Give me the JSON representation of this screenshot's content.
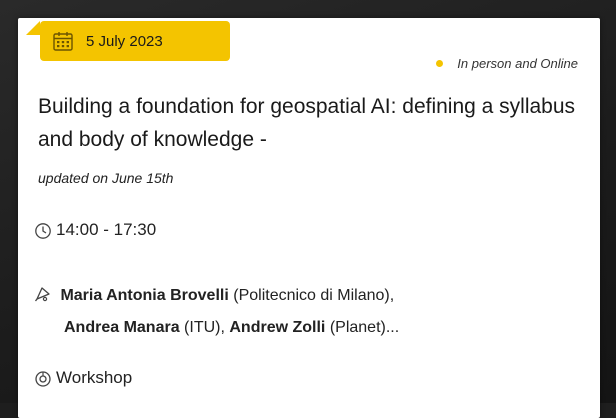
{
  "event": {
    "date": "5 July 2023",
    "format": "In person and Online",
    "title": "Building a foundation for geospatial AI: defining a syllabus and body of knowledge -",
    "updated": "updated on June 15th",
    "time": "14:00 - 17:30",
    "speakers": [
      {
        "name": "Maria Antonia Brovelli",
        "affiliation": "(Politecnico di Milano),"
      },
      {
        "name": "Andrea Manara",
        "affiliation": "(ITU),"
      },
      {
        "name": "Andrew Zolli",
        "affiliation": "(Planet)..."
      }
    ],
    "type": "Workshop"
  },
  "icons": {
    "date": "calendar-icon",
    "format": "status-dot",
    "time": "clock-icon",
    "speakers": "speaker-icon",
    "type": "session-type-icon"
  },
  "colors": {
    "accent": "#f4c400",
    "text": "#1a1a1a",
    "card": "#ffffff",
    "background": "#1e1e1e"
  }
}
